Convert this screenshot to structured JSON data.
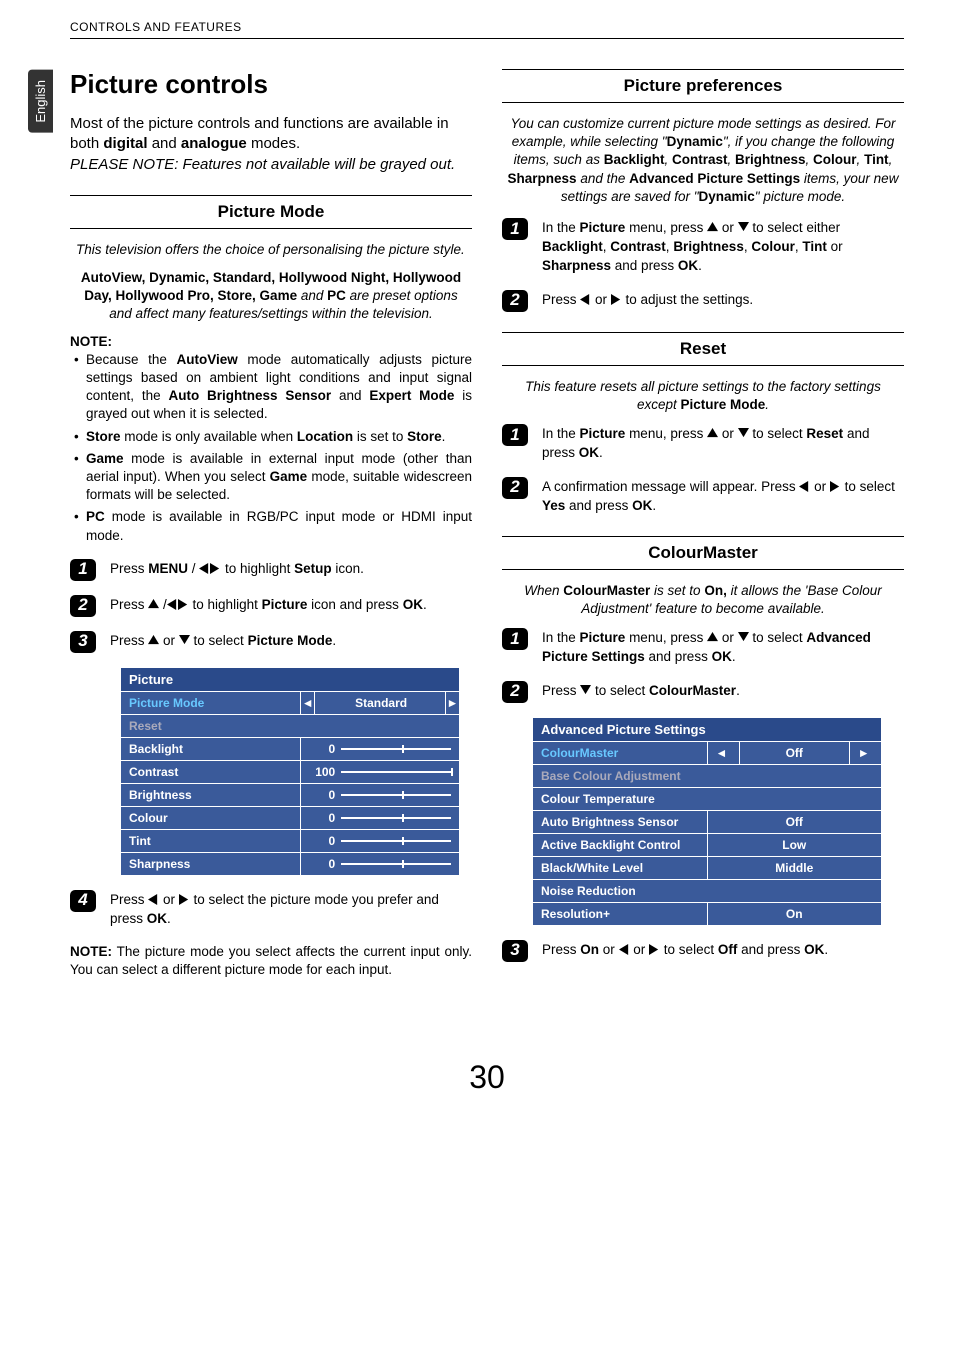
{
  "lang_tab": "English",
  "header": "CONTROLS AND FEATURES",
  "page_number": "30",
  "left": {
    "title": "Picture controls",
    "intro_1": "Most of the picture controls and functions are available in both ",
    "intro_bold1": "digital",
    "intro_mid": " and ",
    "intro_bold2": "analogue",
    "intro_2": " modes.",
    "intro_note": "PLEASE NOTE: Features not available will be grayed out.",
    "sec1_title": "Picture Mode",
    "sec1_lead": "This television offers the choice of personalising the picture style.",
    "sec1_modes_a": "AutoView, Dynamic, Standard, Hollywood Night, Hollywood Day, Hollywood Pro, Store, Game",
    "sec1_modes_b": " and ",
    "sec1_modes_c": "PC",
    "sec1_modes_d": " are preset options and affect many features/settings within the television.",
    "note_label": "NOTE:",
    "notes": [
      {
        "a": "Because the ",
        "b": "AutoView",
        "c": " mode automatically adjusts picture settings based on ambient light conditions and input signal content, the ",
        "d": "Auto Brightness Sensor",
        "e": " and ",
        "f": "Expert Mode",
        "g": " is grayed out when it is selected."
      },
      {
        "a": "",
        "b": "Store",
        "c": " mode is only available when ",
        "d": "Location",
        "e": " is set to ",
        "f": "Store",
        "g": "."
      },
      {
        "a": "",
        "b": "Game",
        "c": " mode is available in external input mode (other than aerial input). When you select ",
        "d": "Game",
        "e": " mode, suitable widescreen formats will be selected.",
        "f": "",
        "g": ""
      },
      {
        "a": "",
        "b": "PC",
        "c": " mode is available in RGB/PC input mode or HDMI input mode.",
        "d": "",
        "e": "",
        "f": "",
        "g": ""
      }
    ],
    "steps": [
      {
        "n": "1",
        "pre": "Press ",
        "b1": "MENU",
        "mid": " / ",
        "icons": "lr",
        "post": " to highlight ",
        "b2": "Setup",
        "end": " icon."
      },
      {
        "n": "2",
        "pre": "Press ",
        "icons": "u lr",
        "post": " to highlight ",
        "b1": "Picture",
        "mid": " icon and press ",
        "b2": "OK",
        "end": "."
      },
      {
        "n": "3",
        "pre": "Press ",
        "icons": "u d",
        "post": " to select ",
        "b1": "Picture Mode",
        "end": "."
      },
      {
        "n": "4",
        "pre": "Press ",
        "icons": "l r",
        "post": " to select the picture mode you prefer and press ",
        "b1": "OK",
        "end": "."
      }
    ],
    "osd_title": "Picture",
    "osd_rows": [
      {
        "label": "Picture Mode",
        "kind": "select",
        "value": "Standard",
        "hl": true
      },
      {
        "label": "Reset",
        "kind": "text",
        "grey": true
      },
      {
        "label": "Backlight",
        "kind": "slider",
        "value": "0",
        "pos": 55
      },
      {
        "label": "Contrast",
        "kind": "slider",
        "value": "100",
        "pos": 100
      },
      {
        "label": "Brightness",
        "kind": "slider",
        "value": "0",
        "pos": 55
      },
      {
        "label": "Colour",
        "kind": "slider",
        "value": "0",
        "pos": 55
      },
      {
        "label": "Tint",
        "kind": "slider",
        "value": "0",
        "pos": 55
      },
      {
        "label": "Sharpness",
        "kind": "slider",
        "value": "0",
        "pos": 55
      }
    ],
    "footnote_pre": "NOTE:",
    "footnote": " The picture mode you select affects the current input only. You can select a different picture mode for each input."
  },
  "right": {
    "sec1_title": "Picture preferences",
    "sec1_lead_a": "You can customize current picture mode settings as desired. For example, while selecting \"",
    "sec1_lead_b": "Dynamic",
    "sec1_lead_c": "\", if you change the following items, such as ",
    "sec1_items": [
      "Backlight",
      "Contrast",
      "Brightness",
      "Colour",
      "Tint",
      "Sharpness"
    ],
    "sec1_lead_d": " and the ",
    "sec1_lead_e": "Advanced Picture Settings",
    "sec1_lead_f": " items, your new settings are saved for \"",
    "sec1_lead_g": "Dynamic",
    "sec1_lead_h": "\" picture mode.",
    "steps1": [
      {
        "n": "1",
        "pre": "In the ",
        "b1": "Picture",
        "mid": " menu, press ",
        "icons": "u d",
        "post": " to select either ",
        "list": [
          "Backlight",
          "Contrast",
          "Brightness",
          "Colour",
          "Tint"
        ],
        "or": " or ",
        "last": "Sharpness",
        "end": " and press ",
        "b2": "OK",
        "dot": "."
      },
      {
        "n": "2",
        "pre": "Press ",
        "icons": "l r",
        "post": " to adjust the settings."
      }
    ],
    "sec2_title": "Reset",
    "sec2_lead_a": "This feature resets all picture settings to the factory settings except ",
    "sec2_lead_b": "Picture Mode",
    "sec2_lead_c": ".",
    "steps2": [
      {
        "n": "1",
        "pre": "In the ",
        "b1": "Picture",
        "mid": " menu, press ",
        "icons": "u d",
        "post": " to select ",
        "b2": "Reset",
        "end": " and press ",
        "b3": "OK",
        "dot": "."
      },
      {
        "n": "2",
        "pre": "A confirmation message will appear. Press ",
        "icons": "l r",
        "post": " to select ",
        "b1": "Yes",
        "end": " and press ",
        "b2": "OK",
        "dot": "."
      }
    ],
    "sec3_title": "ColourMaster",
    "sec3_lead_a": "When ",
    "sec3_lead_b": "ColourMaster",
    "sec3_lead_c": " is set to ",
    "sec3_lead_d": "On,",
    "sec3_lead_e": " it allows the 'Base Colour Adjustment' feature to become available.",
    "steps3": [
      {
        "n": "1",
        "pre": "In the ",
        "b1": "Picture",
        "mid": " menu, press ",
        "icons": "u d",
        "post": " to select ",
        "b2": "Advanced Picture Settings",
        "end": " and press ",
        "b3": "OK",
        "dot": "."
      },
      {
        "n": "2",
        "pre": "Press ",
        "icons": "d",
        "post": " to select ",
        "b1": "ColourMaster",
        "dot": "."
      },
      {
        "n": "3",
        "pre": "Press ",
        "icons": "l r",
        "post": " to select ",
        "b1": "On",
        "mid": " or ",
        "b2": "Off",
        "end": " and press ",
        "b3": "OK",
        "dot": "."
      }
    ],
    "osd2_title": "Advanced Picture Settings",
    "osd2_rows": [
      {
        "label": "ColourMaster",
        "value": "Off",
        "hl": true,
        "select": true
      },
      {
        "label": "Base Colour Adjustment",
        "grey": true
      },
      {
        "label": "Colour Temperature"
      },
      {
        "label": "Auto Brightness Sensor",
        "value": "Off"
      },
      {
        "label": "Active Backlight Control",
        "value": "Low"
      },
      {
        "label": "Black/White Level",
        "value": "Middle"
      },
      {
        "label": "Noise Reduction"
      },
      {
        "label": "Resolution+",
        "value": "On"
      }
    ]
  }
}
